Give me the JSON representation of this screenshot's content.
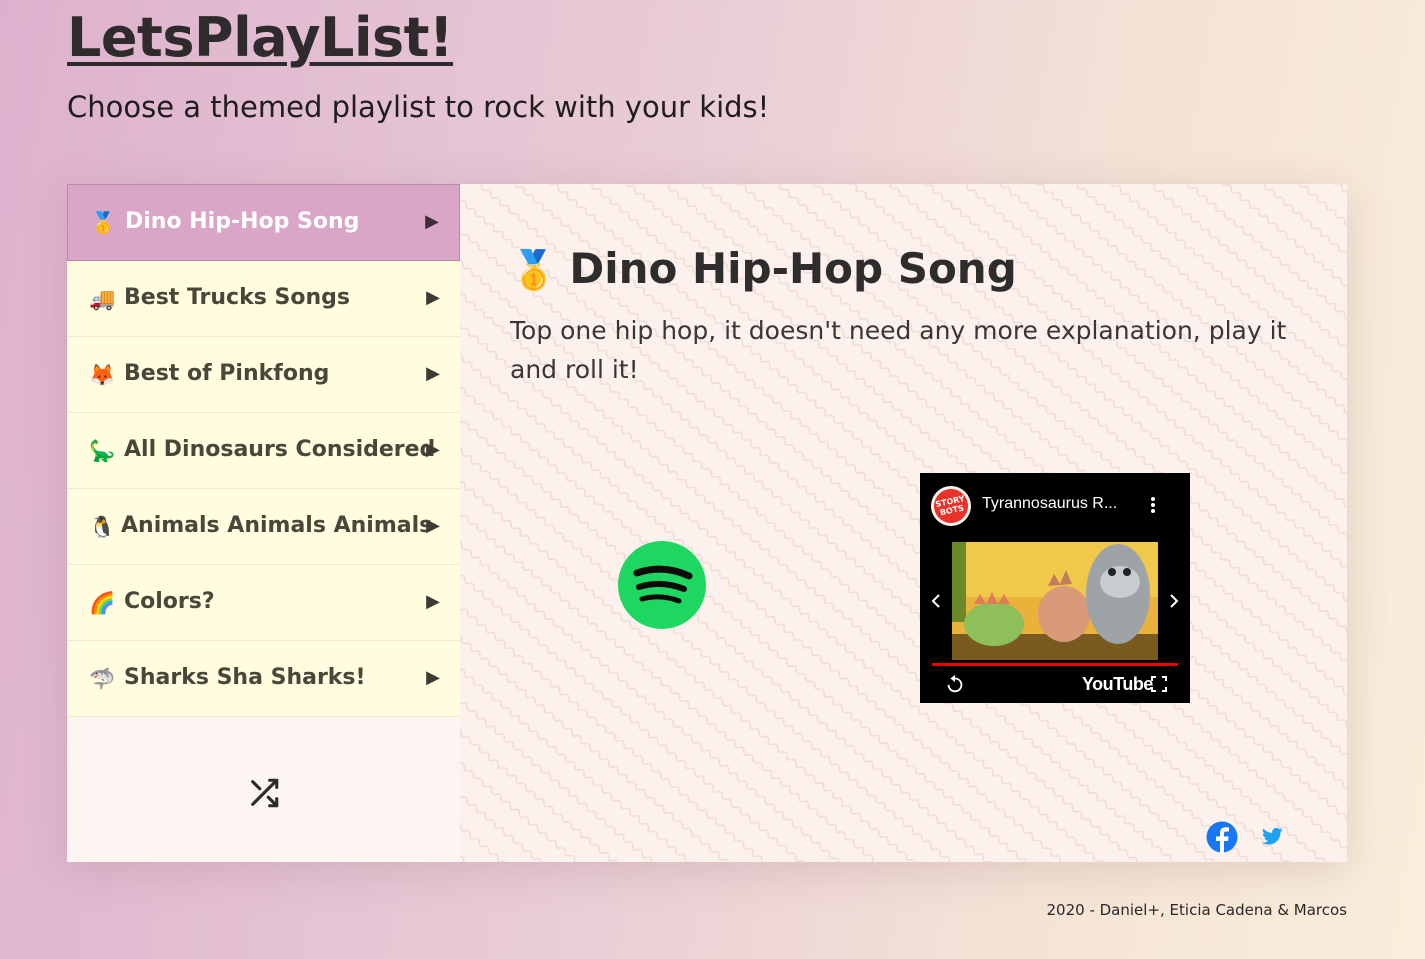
{
  "header": {
    "title": "LetsPlayList!",
    "subtitle": "Choose a themed playlist to rock with your kids!"
  },
  "sidebar": {
    "items": [
      {
        "emoji": "🥇",
        "label": "Dino Hip-Hop Song",
        "arrow": "▶",
        "active": true
      },
      {
        "emoji": "🚚",
        "label": "Best Trucks Songs",
        "arrow": "▶",
        "active": false
      },
      {
        "emoji": "🦊",
        "label": "Best of Pinkfong",
        "arrow": "▶",
        "active": false
      },
      {
        "emoji": "🦕",
        "label": "All Dinosaurs Considered",
        "arrow": "▶",
        "active": false
      },
      {
        "emoji": "🐧",
        "label": "Animals Animals Animals",
        "arrow": "▶",
        "active": false
      },
      {
        "emoji": "🌈",
        "label": "Colors?",
        "arrow": "▶",
        "active": false
      },
      {
        "emoji": "🦈",
        "label": "Sharks Sha Sharks!",
        "arrow": "▶",
        "active": false
      }
    ],
    "shuffle_icon": "shuffle-icon"
  },
  "content": {
    "emoji": "🥇",
    "title": "Dino Hip-Hop Song",
    "description": "Top one hip hop, it doesn't need any more explanation, play it and roll it!",
    "spotify_icon": "spotify-icon",
    "video": {
      "channel_avatar_text": "STORY BOTS",
      "title": "Tyrannosaurus R...",
      "logo": "YouTube",
      "progress_color": "#ee0000"
    },
    "share": {
      "facebook_icon": "facebook-icon",
      "twitter_icon": "twitter-icon"
    }
  },
  "footer": {
    "text": "2020 - Daniel+, Eticia Cadena & Marcos"
  },
  "colors": {
    "active_item": "#d9a6c8",
    "menu_item": "#fffcdf",
    "spotify_green": "#1ed760",
    "facebook_blue": "#1877f2",
    "twitter_blue": "#1da1f2"
  }
}
